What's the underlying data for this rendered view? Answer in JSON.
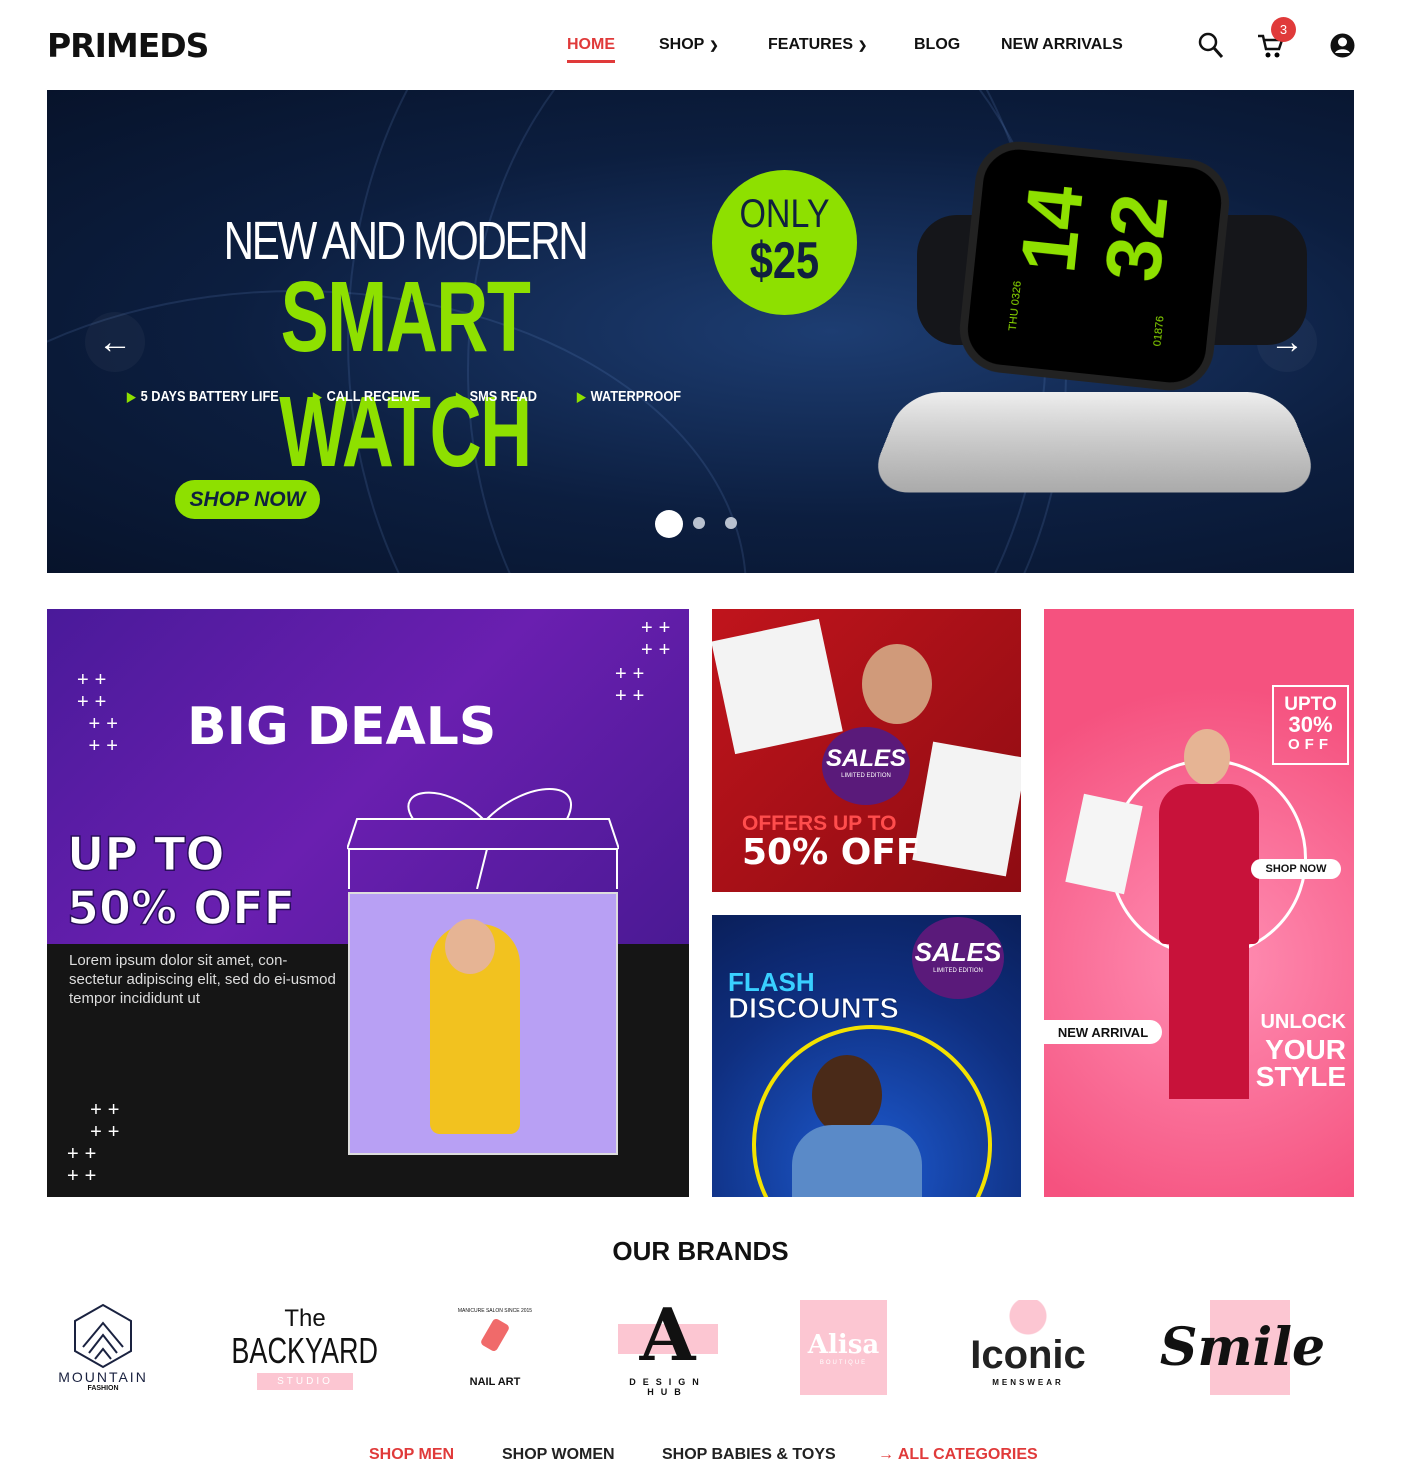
{
  "header": {
    "logo": "PRIMEDS",
    "nav": [
      {
        "label": "HOME",
        "active": true
      },
      {
        "label": "SHOP",
        "dropdown": true
      },
      {
        "label": "FEATURES",
        "dropdown": true
      },
      {
        "label": "BLOG"
      },
      {
        "label": "NEW ARRIVALS"
      }
    ],
    "cart_count": "3",
    "icons": [
      "search-icon",
      "cart-icon",
      "user-icon"
    ]
  },
  "hero": {
    "kicker": "NEW AND MODERN",
    "title": "SMART WATCH",
    "badge_line1": "ONLY",
    "badge_line2": "$25",
    "features": [
      "5 DAYS BATTERY LIFE",
      "CALL RECEIVE",
      "SMS READ",
      "WATERPROOF"
    ],
    "cta": "SHOP NOW",
    "watch_hour": "14",
    "watch_min": "32",
    "watch_day": "THU",
    "watch_date": "0326",
    "watch_steps": "01876",
    "slides": 3,
    "active_slide": 1,
    "accent": "#8ee000"
  },
  "promos": {
    "big": {
      "title": "BIG DEALS",
      "line1": "UP TO",
      "line2": "50% OFF",
      "text": "Lorem ipsum dolor sit amet, con-sectetur adipiscing elit, sed do ei-usmod tempor incididunt ut"
    },
    "sales": {
      "badge": "SALES",
      "badge_sub": "LIMITED EDITION",
      "line1": "OFFERS UP TO",
      "line2": "50% OFF"
    },
    "flash": {
      "line1": "FLASH",
      "line2": "DISCOUNTS",
      "badge": "SALES",
      "badge_sub": "LIMITED EDITION"
    },
    "style": {
      "upto1": "UPTO",
      "upto2": "30%",
      "upto3": "OFF",
      "shop": "SHOP NOW",
      "new": "NEW ARRIVAL",
      "l1": "UNLOCK",
      "l2": "YOUR",
      "l3": "STYLE"
    }
  },
  "brands": {
    "title": "OUR BRANDS",
    "items": [
      {
        "name": "MOUNTAIN",
        "sub": "FASHION"
      },
      {
        "name": "BACKYARD",
        "pre": "The",
        "sub": "STUDIO"
      },
      {
        "name": "NAIL ART",
        "sub": "MANICURE SALON SINCE 2015"
      },
      {
        "name": "A",
        "sub": "DESIGN HUB"
      },
      {
        "name": "Alisa",
        "sub": "BOUTIQUE"
      },
      {
        "name": "Iconic",
        "sub": "MENSWEAR"
      },
      {
        "name": "Smile"
      }
    ]
  },
  "links": [
    {
      "label": "SHOP MEN",
      "active": true
    },
    {
      "label": "SHOP WOMEN"
    },
    {
      "label": "SHOP BABIES & TOYS"
    },
    {
      "label": "ALL CATEGORIES",
      "arrow": "→",
      "accent": true
    }
  ]
}
